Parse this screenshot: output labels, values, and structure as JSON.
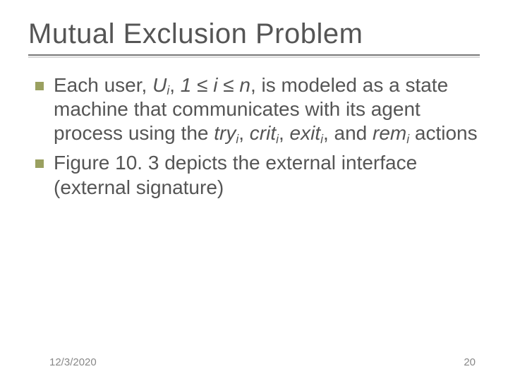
{
  "title": "Mutual Exclusion Problem",
  "bullets": {
    "b1": {
      "pre": "Each user, ",
      "u": "U",
      "sub_i1": "i",
      "mid1": ", ",
      "one": "1 ",
      "leq1": "≤",
      "i_mid": " i ",
      "leq2": "≤",
      "n_mid": " n",
      "mid2": ", is modeled as a state machine that communicates with its agent process using the ",
      "try_w": "try",
      "sub_i2": "i",
      "c1": ", ",
      "crit_w": "crit",
      "sub_i3": "i",
      "c2": ", ",
      "exit_w": "exit",
      "sub_i4": "i",
      "c3": ", and ",
      "rem_w": "rem",
      "sub_i5": "i",
      "tail": " actions"
    },
    "b2": "Figure 10. 3 depicts the external interface (external signature)"
  },
  "footer": {
    "date": "12/3/2020",
    "page": "20"
  }
}
